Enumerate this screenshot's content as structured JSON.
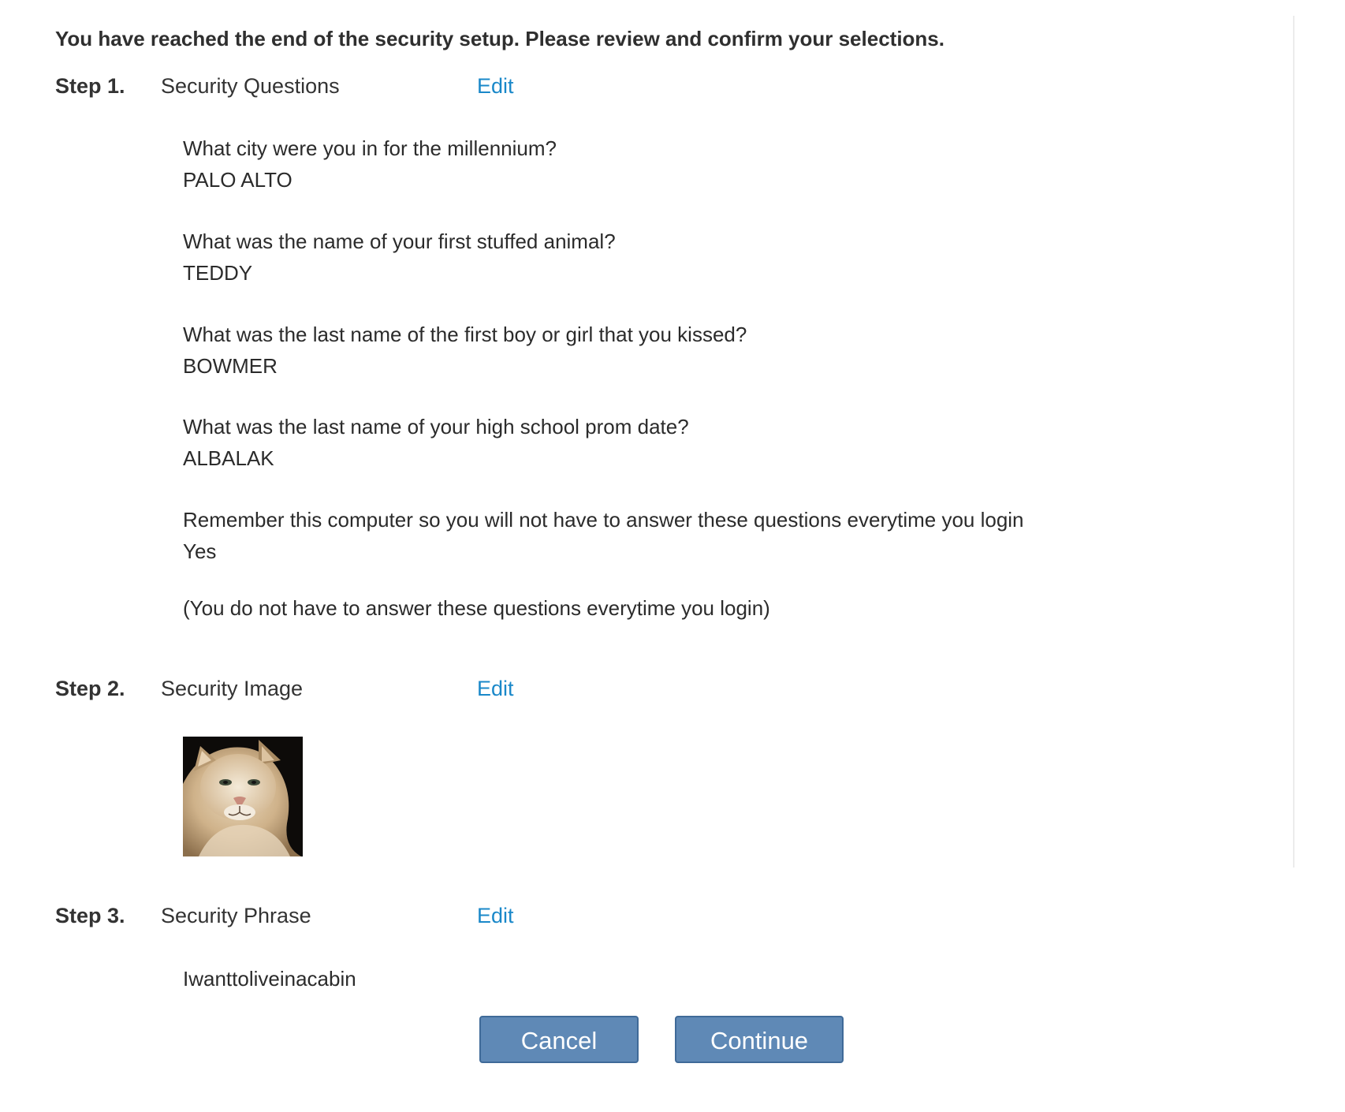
{
  "intro": "You have reached the end of the security setup. Please review and confirm your selections.",
  "steps": [
    {
      "number": "Step 1.",
      "title": "Security Questions",
      "edit_label": "Edit"
    },
    {
      "number": "Step 2.",
      "title": "Security Image",
      "edit_label": "Edit"
    },
    {
      "number": "Step 3.",
      "title": "Security Phrase",
      "edit_label": "Edit"
    }
  ],
  "questions": [
    {
      "question": "What city were you in for the millennium?",
      "answer": "PALO ALTO"
    },
    {
      "question": "What was the name of your first stuffed animal?",
      "answer": "TEDDY"
    },
    {
      "question": "What was the last name of the first boy or girl that you kissed?",
      "answer": "BOWMER"
    },
    {
      "question": "What was the last name of your high school prom date?",
      "answer": "ALBALAK"
    },
    {
      "question": "Remember this computer so you will not have to answer these questions everytime you login",
      "answer": "Yes"
    }
  ],
  "remember_note": "(You do not have to answer these questions everytime you login)",
  "security_image": {
    "icon": "cougar-photo"
  },
  "security_phrase": "Iwanttoliveinacabin",
  "buttons": {
    "cancel": "Cancel",
    "continue": "Continue"
  },
  "colors": {
    "link": "#1a88c9",
    "button": "#5f89b6",
    "button_border": "#3f6a98"
  }
}
